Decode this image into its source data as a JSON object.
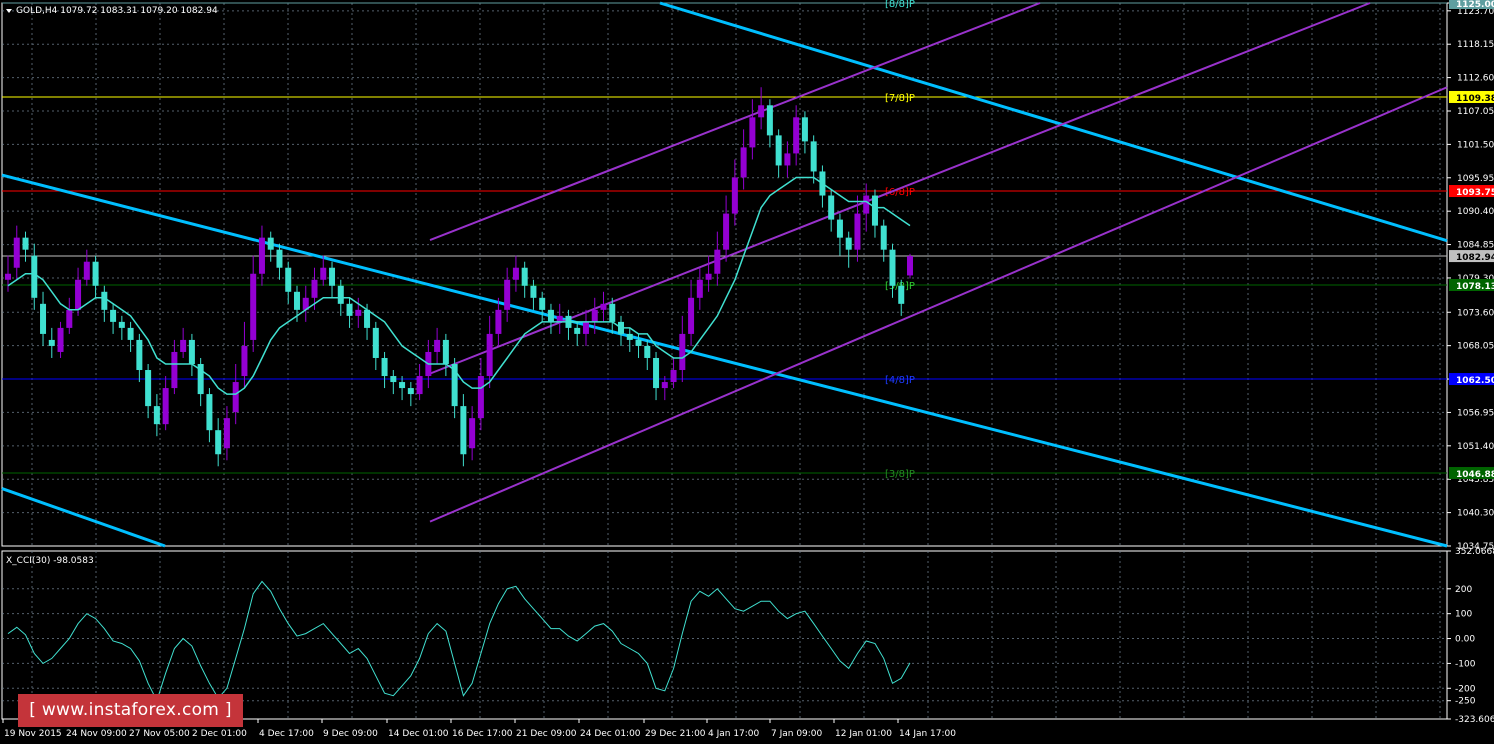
{
  "window": {
    "title": "GOLD,H4 1079.72 1083.31 1079.20 1082.94",
    "symbol": "GOLD",
    "timeframe": "H4",
    "ohlc": {
      "open": 1079.72,
      "high": 1083.31,
      "low": 1079.2,
      "close": 1082.94
    }
  },
  "chart_data": [
    {
      "type": "candlestick",
      "title": "GOLD,H4 1079.72 1083.31 1079.20 1082.94",
      "ylim": [
        1034.75,
        1125.0
      ],
      "yticks": [
        "1125.00",
        "1123.70",
        "1118.15",
        "1112.60",
        "1107.05",
        "1101.50",
        "1095.95",
        "1090.40",
        "1084.85",
        "1079.30",
        "1073.60",
        "1068.05",
        "1062.50",
        "1056.95",
        "1051.40",
        "1045.85",
        "1040.30",
        "1034.75"
      ],
      "xticks": [
        "19 Nov 2015",
        "24 Nov 09:00",
        "27 Nov 05:00",
        "2 Dec 01:00",
        "4 Dec 17:00",
        "9 Dec 09:00",
        "14 Dec 01:00",
        "16 Dec 17:00",
        "21 Dec 09:00",
        "24 Dec 01:00",
        "29 Dec 21:00",
        "4 Jan 17:00",
        "7 Jan 09:00",
        "12 Jan 01:00",
        "14 Jan 17:00"
      ],
      "grid": true,
      "series": [
        {
          "kind": "candles",
          "bull_color": "#9400d3",
          "bear_color": "#40e0d0",
          "closes": [
            1080,
            1086,
            1084,
            1076,
            1070,
            1068,
            1071,
            1074,
            1079,
            1082,
            1078,
            1074,
            1072,
            1071,
            1069,
            1064,
            1058,
            1055,
            1061,
            1067,
            1069,
            1065,
            1060,
            1054,
            1050,
            1056,
            1062,
            1068,
            1080,
            1086,
            1084,
            1081,
            1077,
            1074,
            1076,
            1079,
            1081,
            1078,
            1075,
            1073,
            1074,
            1071,
            1066,
            1063,
            1062,
            1061,
            1060,
            1063,
            1067,
            1069,
            1065,
            1058,
            1050,
            1056,
            1063,
            1070,
            1074,
            1079,
            1081,
            1078,
            1076,
            1074,
            1072,
            1073,
            1071,
            1070,
            1072,
            1074,
            1075,
            1072,
            1070,
            1069,
            1068,
            1066,
            1061,
            1062,
            1064,
            1070,
            1076,
            1079,
            1080,
            1084,
            1090,
            1096,
            1101,
            1106,
            1108,
            1103,
            1098,
            1100,
            1106,
            1102,
            1097,
            1093,
            1089,
            1086,
            1084,
            1090,
            1093,
            1088,
            1084,
            1078,
            1075,
            1082.94
          ],
          "opens": [
            1079,
            1081,
            1086,
            1083,
            1075,
            1069,
            1067,
            1071,
            1074,
            1079,
            1082,
            1077,
            1074,
            1072,
            1071,
            1069,
            1064,
            1058,
            1055,
            1061,
            1067,
            1069,
            1065,
            1060,
            1054,
            1051,
            1057,
            1063,
            1069,
            1080,
            1086,
            1084,
            1081,
            1077,
            1074,
            1076,
            1079,
            1081,
            1078,
            1075,
            1073,
            1074,
            1071,
            1066,
            1063,
            1062,
            1061,
            1060,
            1063,
            1067,
            1069,
            1065,
            1058,
            1051,
            1056,
            1063,
            1070,
            1074,
            1079,
            1081,
            1078,
            1076,
            1074,
            1072,
            1073,
            1071,
            1070,
            1072,
            1074,
            1075,
            1072,
            1070,
            1069,
            1068,
            1066,
            1061,
            1062,
            1064,
            1070,
            1076,
            1079,
            1080,
            1084,
            1090,
            1096,
            1101,
            1106,
            1108,
            1103,
            1098,
            1100,
            1106,
            1102,
            1097,
            1093,
            1089,
            1086,
            1084,
            1090,
            1093,
            1088,
            1084,
            1078,
            1079.72
          ],
          "highs": [
            1083,
            1088,
            1087,
            1085,
            1077,
            1071,
            1072,
            1076,
            1081,
            1084,
            1083,
            1078,
            1075,
            1073,
            1072,
            1070,
            1065,
            1060,
            1063,
            1069,
            1071,
            1070,
            1066,
            1061,
            1056,
            1058,
            1065,
            1072,
            1083,
            1088,
            1087,
            1085,
            1082,
            1078,
            1078,
            1081,
            1083,
            1082,
            1079,
            1076,
            1076,
            1075,
            1072,
            1067,
            1064,
            1063,
            1062,
            1065,
            1069,
            1071,
            1070,
            1066,
            1060,
            1058,
            1066,
            1073,
            1076,
            1081,
            1083,
            1082,
            1079,
            1077,
            1075,
            1075,
            1074,
            1072,
            1074,
            1076,
            1077,
            1076,
            1073,
            1071,
            1070,
            1069,
            1067,
            1063,
            1066,
            1073,
            1079,
            1081,
            1083,
            1087,
            1093,
            1099,
            1104,
            1109,
            1111,
            1109,
            1104,
            1102,
            1108,
            1107,
            1103,
            1098,
            1094,
            1090,
            1087,
            1093,
            1095,
            1094,
            1089,
            1085,
            1079,
            1083.31
          ],
          "lows": [
            1077,
            1079,
            1082,
            1074,
            1068,
            1066,
            1066,
            1070,
            1073,
            1078,
            1076,
            1072,
            1070,
            1069,
            1067,
            1062,
            1056,
            1053,
            1054,
            1060,
            1066,
            1063,
            1058,
            1052,
            1048,
            1049,
            1055,
            1061,
            1067,
            1078,
            1082,
            1079,
            1075,
            1072,
            1072,
            1074,
            1078,
            1076,
            1073,
            1071,
            1071,
            1069,
            1064,
            1061,
            1060,
            1059,
            1058,
            1059,
            1061,
            1065,
            1063,
            1056,
            1048,
            1049,
            1054,
            1061,
            1068,
            1072,
            1077,
            1076,
            1074,
            1072,
            1070,
            1070,
            1069,
            1068,
            1068,
            1070,
            1072,
            1070,
            1068,
            1067,
            1066,
            1064,
            1059,
            1059,
            1061,
            1062,
            1068,
            1074,
            1077,
            1078,
            1082,
            1088,
            1094,
            1099,
            1104,
            1101,
            1096,
            1096,
            1098,
            1100,
            1095,
            1091,
            1087,
            1083,
            1081,
            1082,
            1087,
            1086,
            1082,
            1076,
            1073,
            1079.2
          ]
        },
        {
          "kind": "moving-average",
          "color": "#40e0d0",
          "values": [
            1078,
            1079,
            1080,
            1080,
            1079,
            1077,
            1075,
            1074,
            1074,
            1075,
            1076,
            1076,
            1075,
            1074,
            1073,
            1071,
            1069,
            1066,
            1065,
            1065,
            1065,
            1065,
            1064,
            1063,
            1061,
            1060,
            1060,
            1061,
            1063,
            1066,
            1069,
            1071,
            1072,
            1073,
            1074,
            1075,
            1076,
            1076,
            1076,
            1076,
            1075,
            1074,
            1073,
            1072,
            1070,
            1068,
            1067,
            1066,
            1065,
            1065,
            1065,
            1064,
            1062,
            1061,
            1061,
            1062,
            1064,
            1066,
            1068,
            1070,
            1071,
            1072,
            1072,
            1072,
            1072,
            1072,
            1072,
            1072,
            1072,
            1072,
            1071,
            1071,
            1070,
            1070,
            1068,
            1067,
            1066,
            1066,
            1067,
            1069,
            1071,
            1073,
            1076,
            1079,
            1083,
            1087,
            1091,
            1093,
            1094,
            1095,
            1096,
            1096,
            1096,
            1095,
            1094,
            1093,
            1092,
            1092,
            1092,
            1091,
            1091,
            1090,
            1089,
            1088
          ]
        }
      ],
      "levels": [
        {
          "value": 1125.0,
          "label": "1125.00",
          "marker": "[8/8]P",
          "color": "#5f9ea0",
          "marker_color": "#40e0d0"
        },
        {
          "value": 1109.38,
          "label": "1109.38",
          "marker": "[7/8]P",
          "color": "#ffff00",
          "marker_color": "#ffff00"
        },
        {
          "value": 1093.75,
          "label": "1093.75",
          "marker": "[6/8]P",
          "color": "#ff0000",
          "marker_color": "#ff0000"
        },
        {
          "value": 1082.94,
          "label": "1082.94",
          "marker": "",
          "color": "#c0c0c0",
          "marker_color": "#ffffff"
        },
        {
          "value": 1078.13,
          "label": "1078.13",
          "marker": "[5/8]P",
          "color": "#006400",
          "marker_color": "#32cd32"
        },
        {
          "value": 1062.5,
          "label": "1062.50",
          "marker": "[4/8]P",
          "color": "#0000ff",
          "marker_color": "#1e3cff"
        },
        {
          "value": 1046.88,
          "label": "1046.88",
          "marker": "[3/8]P",
          "color": "#006400",
          "marker_color": "#228b22"
        }
      ],
      "trendlines": [
        {
          "name": "down-channel",
          "color": "#00bfff"
        },
        {
          "name": "up-channel",
          "color": "#9932cc"
        }
      ]
    },
    {
      "type": "line",
      "title": "X_CCI(30) -98.0583",
      "ylim": [
        -323.6065,
        352.0668
      ],
      "yticks": [
        "352.0668",
        "200",
        "100",
        "0.00",
        "-100",
        "-200",
        "-250",
        "-323.6065"
      ],
      "series": [
        {
          "name": "X_CCI(30)",
          "color": "#40e0d0",
          "values": [
            20,
            45,
            15,
            -60,
            -100,
            -80,
            -40,
            0,
            60,
            100,
            80,
            40,
            -10,
            -20,
            -40,
            -90,
            -180,
            -250,
            -140,
            -40,
            0,
            -30,
            -110,
            -180,
            -240,
            -200,
            -80,
            40,
            180,
            230,
            190,
            120,
            60,
            10,
            20,
            40,
            60,
            20,
            -20,
            -60,
            -40,
            -80,
            -150,
            -220,
            -230,
            -190,
            -150,
            -80,
            20,
            60,
            30,
            -100,
            -230,
            -180,
            -60,
            60,
            140,
            200,
            210,
            160,
            120,
            80,
            40,
            40,
            10,
            -10,
            20,
            50,
            60,
            30,
            -20,
            -40,
            -60,
            -100,
            -200,
            -210,
            -120,
            20,
            150,
            190,
            170,
            200,
            160,
            120,
            110,
            130,
            150,
            150,
            110,
            80,
            100,
            110,
            60,
            10,
            -40,
            -90,
            -120,
            -60,
            -10,
            -20,
            -80,
            -180,
            -160,
            -98.0583
          ]
        }
      ]
    }
  ],
  "watermark": "[  www.instaforex.com  ]"
}
